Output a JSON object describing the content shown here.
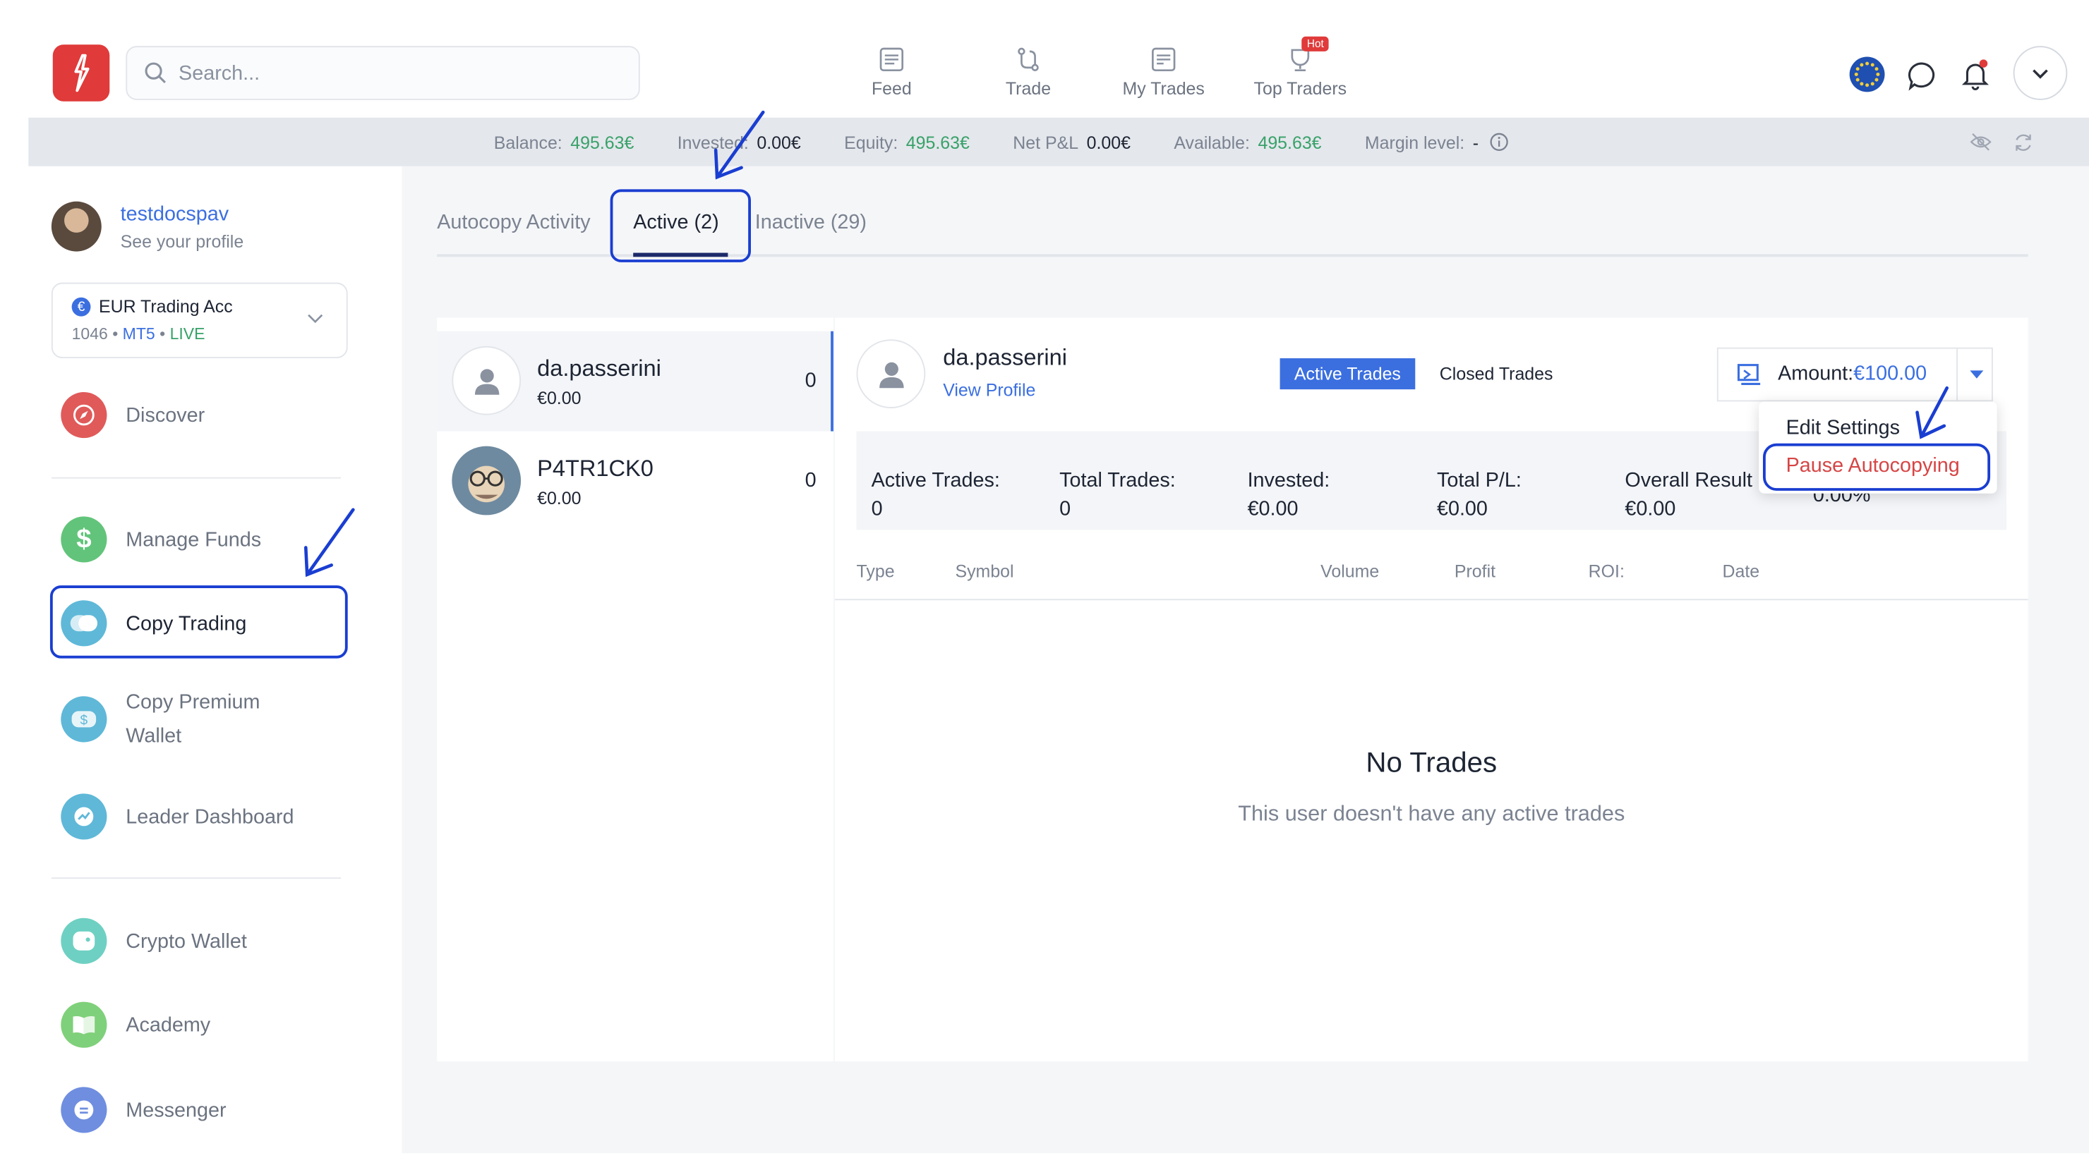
{
  "header": {
    "search_placeholder": "Search...",
    "nav": [
      {
        "label": "Feed",
        "icon": "feed-icon"
      },
      {
        "label": "Trade",
        "icon": "trade-icon"
      },
      {
        "label": "My Trades",
        "icon": "my-trades-icon"
      },
      {
        "label": "Top Traders",
        "icon": "top-traders-icon"
      }
    ],
    "hot_badge": "Hot"
  },
  "balance_bar": {
    "balance_label": "Balance:",
    "balance_value": "495.63€",
    "invested_label": "Invested:",
    "invested_value": "0.00€",
    "equity_label": "Equity:",
    "equity_value": "495.63€",
    "netpl_label": "Net P&L",
    "netpl_value": "0.00€",
    "available_label": "Available:",
    "available_value": "495.63€",
    "margin_label": "Margin level:",
    "margin_value": "-"
  },
  "sidebar": {
    "username": "testdocspav",
    "profile_link": "See your profile",
    "account_name": "EUR Trading Acc",
    "account_number": "1046",
    "account_platform": "MT5",
    "account_mode": "LIVE",
    "items": [
      {
        "label": "Discover"
      },
      {
        "label": "Manage Funds"
      },
      {
        "label": "Copy Trading"
      },
      {
        "label": "Copy Premium"
      },
      {
        "label": "Wallet"
      },
      {
        "label": "Leader Dashboard"
      },
      {
        "label": "Crypto Wallet"
      },
      {
        "label": "Academy"
      },
      {
        "label": "Messenger"
      }
    ]
  },
  "tabs": {
    "autocopy": "Autocopy Activity",
    "active": "Active (2)",
    "inactive": "Inactive (29)"
  },
  "traders": [
    {
      "name": "da.passerini",
      "amount": "€0.00",
      "count": "0"
    },
    {
      "name": "P4TR1CK0",
      "amount": "€0.00",
      "count": "0"
    }
  ],
  "detail": {
    "name": "da.passerini",
    "view_profile": "View Profile",
    "active_trades_btn": "Active Trades",
    "closed_trades_btn": "Closed Trades",
    "amount_label": "Amount:",
    "amount_value": "€100.00",
    "dropdown": {
      "edit": "Edit Settings",
      "pause": "Pause Autocopying"
    },
    "stats": [
      {
        "label": "Active Trades:",
        "value": "0"
      },
      {
        "label": "Total Trades:",
        "value": "0"
      },
      {
        "label": "Invested:",
        "value": "€0.00"
      },
      {
        "label": "Total P/L:",
        "value": "€0.00"
      },
      {
        "label": "Overall Result",
        "value": "€0.00"
      }
    ],
    "roi_partial": "0.00%",
    "columns": [
      "Type",
      "Symbol",
      "Volume",
      "Profit",
      "ROI:",
      "Date"
    ],
    "empty_title": "No Trades",
    "empty_text": "This user doesn't have any active trades"
  },
  "colors": {
    "brand_red": "#e03a3a",
    "accent_blue": "#3b6fe0",
    "positive_green": "#38a169",
    "annotation_blue": "#1a3ed1",
    "pause_red": "#d64545"
  }
}
